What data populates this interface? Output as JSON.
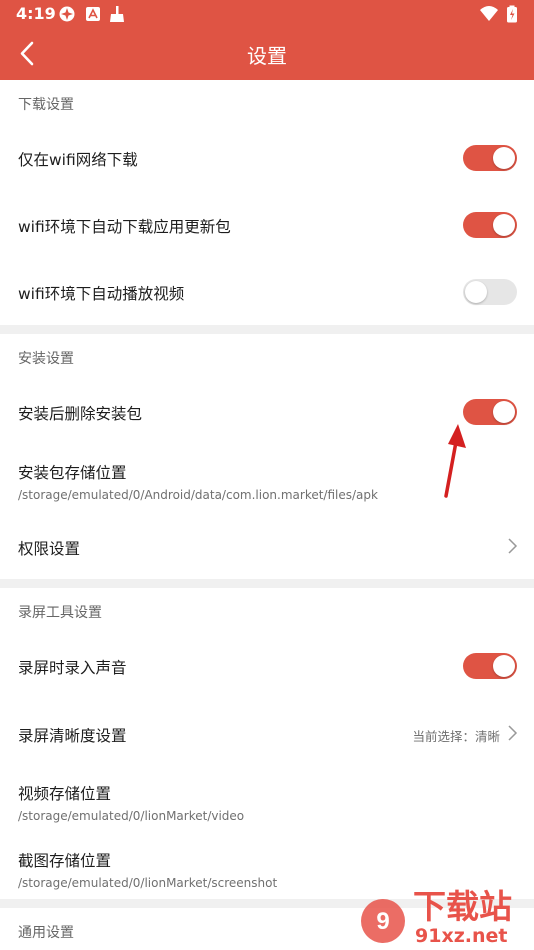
{
  "status": {
    "time": "4:19"
  },
  "header": {
    "title": "设置"
  },
  "sections": {
    "download": {
      "header": "下载设置",
      "wifi_only": {
        "label": "仅在wifi网络下载",
        "on": true
      },
      "wifi_auto_update": {
        "label": "wifi环境下自动下载应用更新包",
        "on": true
      },
      "wifi_autoplay": {
        "label": "wifi环境下自动播放视频",
        "on": false
      }
    },
    "install": {
      "header": "安装设置",
      "delete_after_install": {
        "label": "安装后删除安装包",
        "on": true
      },
      "storage_location": {
        "label": "安装包存储位置",
        "path": "/storage/emulated/0/Android/data/com.lion.market/files/apk"
      },
      "permissions": {
        "label": "权限设置"
      }
    },
    "recording": {
      "header": "录屏工具设置",
      "record_audio": {
        "label": "录屏时录入声音",
        "on": true
      },
      "clarity": {
        "label": "录屏清晰度设置",
        "value": "当前选择：清晰"
      },
      "video_location": {
        "label": "视频存储位置",
        "path": "/storage/emulated/0/lionMarket/video"
      },
      "screenshot_location": {
        "label": "截图存储位置",
        "path": "/storage/emulated/0/lionMarket/screenshot"
      }
    },
    "general": {
      "header": "通用设置"
    }
  },
  "watermark": {
    "brand": "下载站",
    "domain": "91xz.net"
  },
  "colors": {
    "accent": "#df5444",
    "toggle_off": "#e6e6e6",
    "divider": "#f0f0f0"
  },
  "icons": [
    "back-arrow-icon",
    "chevron-right-icon",
    "wifi-icon",
    "battery-icon",
    "cleaner-icon"
  ]
}
